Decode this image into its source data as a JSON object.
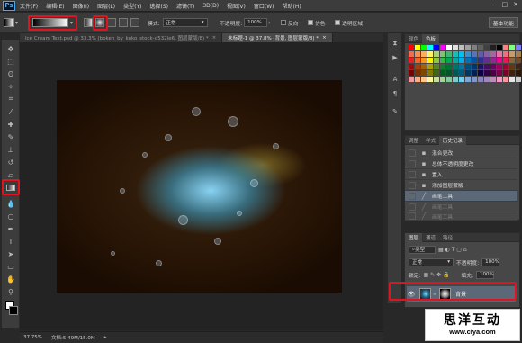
{
  "app": {
    "logo": "Ps"
  },
  "menu": [
    "文件(F)",
    "编辑(E)",
    "图像(I)",
    "图层(L)",
    "类型(Y)",
    "选择(S)",
    "滤镜(T)",
    "3D(D)",
    "视图(V)",
    "窗口(W)",
    "帮助(H)"
  ],
  "window_controls": [
    "—",
    "□",
    "✕"
  ],
  "options": {
    "mode_label": "模式:",
    "mode_value": "正常",
    "opacity_label": "不透明度:",
    "opacity_value": "100%",
    "reverse_label": "反向",
    "dither_label": "仿色",
    "transparency_label": "透明区域",
    "workspace_button": "基本功能"
  },
  "tabs": [
    {
      "label": "Ice Cream Text.psd @ 33.3% (bokeh_by_koko_stock-d532le6, 图层蒙版/8) *",
      "close": "×",
      "active": false
    },
    {
      "label": "未标题-1 @ 37.8% (背景, 图层蒙版/8) *",
      "close": "×",
      "active": true
    }
  ],
  "status": {
    "zoom": "37.75%",
    "doc_label": "文档:5.49M/15.0M"
  },
  "swatch_panel": {
    "tabs": [
      "颜色",
      "色板"
    ]
  },
  "swatch_colors": [
    "#ff0000",
    "#ffff00",
    "#00ff00",
    "#00ffff",
    "#0000ff",
    "#ff00ff",
    "#ffffff",
    "#e0e0e0",
    "#c0c0c0",
    "#a0a0a0",
    "#808080",
    "#606060",
    "#404040",
    "#202020",
    "#000000",
    "#ff8080",
    "#80ff80",
    "#8080ff",
    "#f26c4f",
    "#f68e55",
    "#fbaf5c",
    "#fff467",
    "#acd372",
    "#7cc576",
    "#3bb878",
    "#1abbb4",
    "#00bff3",
    "#438ccb",
    "#5574b9",
    "#605ca8",
    "#855fa8",
    "#a763a8",
    "#f06ea9",
    "#f26d7d",
    "#c69c6d",
    "#a67c52",
    "#ed1c24",
    "#f26522",
    "#f7941d",
    "#fff200",
    "#8dc73f",
    "#39b54a",
    "#00a651",
    "#00a99d",
    "#00aeef",
    "#0072bc",
    "#0054a6",
    "#2e3192",
    "#662d91",
    "#92278f",
    "#ec008c",
    "#ed145b",
    "#8c6239",
    "#754c24",
    "#9e0b0f",
    "#a0410d",
    "#a36209",
    "#aba000",
    "#598527",
    "#1a7b30",
    "#007236",
    "#00746b",
    "#0076a3",
    "#004b80",
    "#003471",
    "#1b1464",
    "#440e62",
    "#630460",
    "#9e005d",
    "#9e0039",
    "#603913",
    "#3c2415",
    "#790000",
    "#7b2e00",
    "#7d4900",
    "#827b00",
    "#406618",
    "#005e20",
    "#005826",
    "#005952",
    "#005b7f",
    "#003663",
    "#002157",
    "#0d004c",
    "#32004b",
    "#4b0049",
    "#7b0046",
    "#7a0026",
    "#42210b",
    "#2d1606",
    "#f5989d",
    "#f9ad81",
    "#fdc68a",
    "#fff79a",
    "#c4df9b",
    "#a3d39c",
    "#82ca9d",
    "#7bcdc8",
    "#6ecff6",
    "#7ea7d8",
    "#8493ca",
    "#8882be",
    "#a186be",
    "#bc8cbf",
    "#f49ac2",
    "#f6989d",
    "#e6e6e6",
    "#cccccc"
  ],
  "history_panel": {
    "tabs": [
      "调整",
      "样式",
      "历史记录"
    ]
  },
  "history": [
    {
      "label": "混合更改",
      "icon": "history-state-icon",
      "state": "normal"
    },
    {
      "label": "总体不透明度更改",
      "icon": "history-state-icon",
      "state": "normal"
    },
    {
      "label": "置入",
      "icon": "history-state-icon",
      "state": "normal"
    },
    {
      "label": "添加图层蒙版",
      "icon": "history-state-icon",
      "state": "normal"
    },
    {
      "label": "画笔工具",
      "icon": "brush-icon",
      "state": "current"
    },
    {
      "label": "画笔工具",
      "icon": "brush-icon",
      "state": "faded"
    },
    {
      "label": "画笔工具",
      "icon": "brush-icon",
      "state": "faded"
    }
  ],
  "layers_panel": {
    "tabs": [
      "图层",
      "通道",
      "路径"
    ],
    "kind_filter": "类型",
    "blend_mode": "正常",
    "opacity_label": "不透明度:",
    "opacity_value": "100%",
    "lock_label": "锁定:",
    "fill_label": "填充:",
    "fill_value": "100%",
    "layer_name": "背景"
  },
  "watermark": {
    "cn": "思洋互动",
    "url": "www.ciya.com"
  }
}
